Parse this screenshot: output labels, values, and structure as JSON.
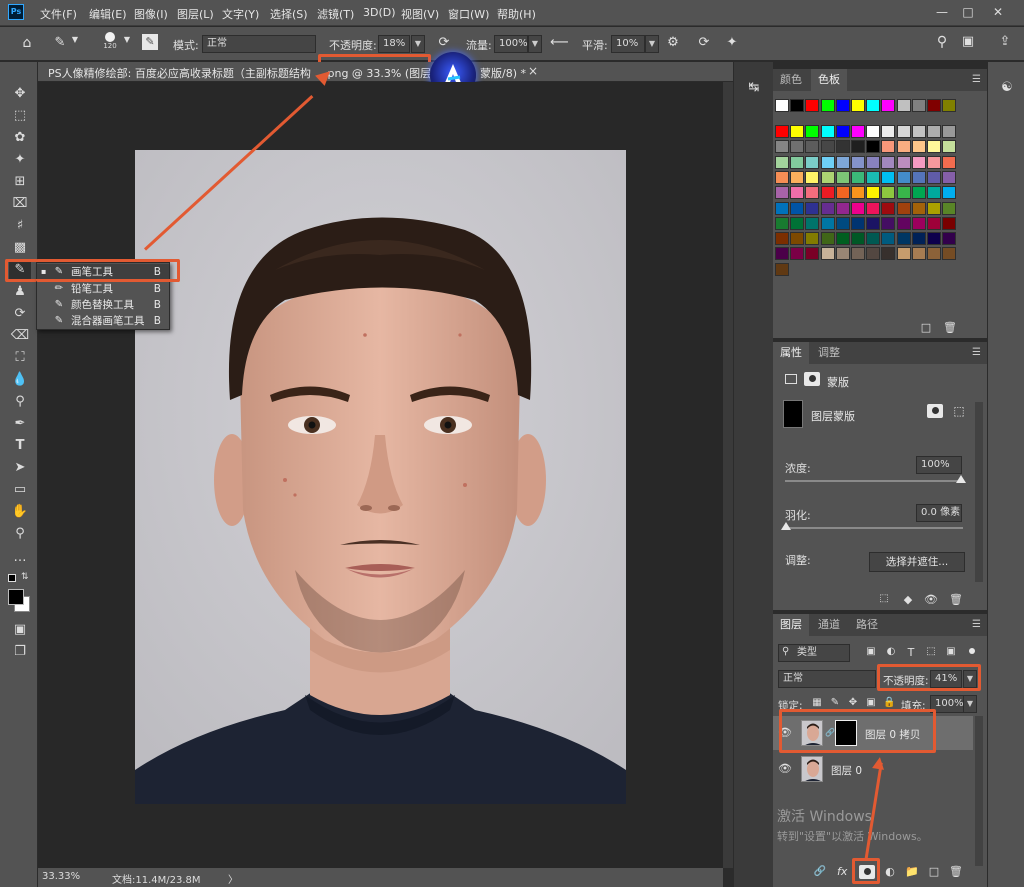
{
  "app": {
    "logo": "Ps"
  },
  "menu": [
    "文件(F)",
    "编辑(E)",
    "图像(I)",
    "图层(L)",
    "文字(Y)",
    "选择(S)",
    "滤镜(T)",
    "3D(D)",
    "视图(V)",
    "窗口(W)",
    "帮助(H)"
  ],
  "options": {
    "brush_size": "120",
    "mode_label": "模式:",
    "mode_value": "正常",
    "opacity_label": "不透明度:",
    "opacity_value": "18%",
    "flow_label": "流量:",
    "flow_value": "100%",
    "smooth_label": "平滑:",
    "smooth_value": "10%"
  },
  "document": {
    "tab_title": "PS人像精修绘部:  百度必应高收录标题（主副标题结构",
    "tab_suffix": ".png @ 33.3% (图层 0",
    "tab_suffix2": "蒙版/8) *",
    "close": "×"
  },
  "flyout": [
    {
      "icon": "brush-icon",
      "label": "画笔工具",
      "key": "B",
      "active": true
    },
    {
      "icon": "pencil-icon",
      "label": "铅笔工具",
      "key": "B",
      "active": false
    },
    {
      "icon": "color-replace-icon",
      "label": "颜色替换工具",
      "key": "B",
      "active": false
    },
    {
      "icon": "mixer-brush-icon",
      "label": "混合器画笔工具",
      "key": "B",
      "active": false
    }
  ],
  "status": {
    "zoom": "33.33%",
    "doc": "文档:11.4M/23.8M",
    "arrow": "〉"
  },
  "swatches_panel": {
    "tabs": [
      "颜色",
      "色板"
    ],
    "active": "色板"
  },
  "properties_panel": {
    "tabs": [
      "属性",
      "调整"
    ],
    "active": "属性",
    "section": "蒙版",
    "mask_label": "图层蒙版",
    "density_label": "浓度:",
    "density_value": "100%",
    "feather_label": "羽化:",
    "feather_value": "0.0 像素",
    "adjust_label": "调整:",
    "select_mask_btn": "选择并遮住..."
  },
  "layers_panel": {
    "tabs": [
      "图层",
      "通道",
      "路径"
    ],
    "active": "图层",
    "kind_filter": "类型",
    "blend_mode": "正常",
    "opacity_label": "不透明度:",
    "opacity_value": "41%",
    "lock_label": "锁定:",
    "fill_label": "填充:",
    "fill_value": "100%",
    "layers": [
      {
        "name": "图层 0 拷贝",
        "has_mask": true,
        "selected": true
      },
      {
        "name": "图层 0",
        "has_mask": false,
        "selected": false
      }
    ],
    "fx_label": "fx"
  },
  "watermark": {
    "line1": "激活 Windows",
    "line2": "转到\"设置\"以激活 Windows。"
  },
  "colors": {
    "accent": "#e25a32",
    "panel": "#535353",
    "canvas": "#282828"
  },
  "swatch_rows": [
    [
      "#ffffff",
      "#000000",
      "#ff0000",
      "#00ff00",
      "#0000ff",
      "#ffff00",
      "#00ffff",
      "#ff00ff",
      "#c0c0c0",
      "#808080",
      "#800000",
      "#808000"
    ],
    [
      "#ff0000",
      "#ffff00",
      "#00ff00",
      "#00ffff",
      "#0000ff",
      "#ff00ff",
      "#ffffff",
      "#ebebeb",
      "#d6d6d6",
      "#c2c2c2",
      "#adadad",
      "#999999"
    ],
    [
      "#858585",
      "#707070",
      "#5c5c5c",
      "#474747",
      "#333333",
      "#1f1f1f",
      "#000000",
      "#f7977a",
      "#f9ad81",
      "#fdc68a",
      "#fff79a",
      "#c4df9b"
    ],
    [
      "#a3d39c",
      "#82ca9d",
      "#7bcdc8",
      "#6ecff6",
      "#7ea7d8",
      "#8493ca",
      "#8882be",
      "#a187be",
      "#bc8dbf",
      "#f49ac2",
      "#f6989d",
      "#f26c4f"
    ],
    [
      "#f68e55",
      "#fbaf5c",
      "#fff467",
      "#acd372",
      "#7cc576",
      "#3bb878",
      "#1abbb4",
      "#00bff3",
      "#438cca",
      "#5574b9",
      "#605ca8",
      "#855fa8"
    ],
    [
      "#a763a8",
      "#f06ea9",
      "#f26d7d",
      "#ed1c24",
      "#f26522",
      "#f7941d",
      "#fff200",
      "#8dc73f",
      "#39b54a",
      "#00a651",
      "#00a99d",
      "#00aeef"
    ],
    [
      "#0072bc",
      "#0054a6",
      "#2e3192",
      "#662d91",
      "#92278f",
      "#ec008c",
      "#ed145b",
      "#9e0b0f",
      "#a0410d",
      "#a3620a",
      "#aba000",
      "#598527"
    ],
    [
      "#197b30",
      "#007236",
      "#00746b",
      "#0076a3",
      "#004a80",
      "#003471",
      "#1b1464",
      "#440e62",
      "#630460",
      "#9e005d",
      "#9e0039",
      "#790000"
    ],
    [
      "#7b2e00",
      "#7d4900",
      "#827b00",
      "#406618",
      "#005e20",
      "#005826",
      "#005952",
      "#005b7f",
      "#003663",
      "#002157",
      "#0d004c",
      "#32004b"
    ],
    [
      "#4b0049",
      "#7b0046",
      "#7a0026",
      "#c7b299",
      "#998675",
      "#736357",
      "#534741",
      "#37302d",
      "#c69c6d",
      "#a67c52",
      "#8c6239",
      "#754c24"
    ],
    [
      "#603913"
    ]
  ]
}
